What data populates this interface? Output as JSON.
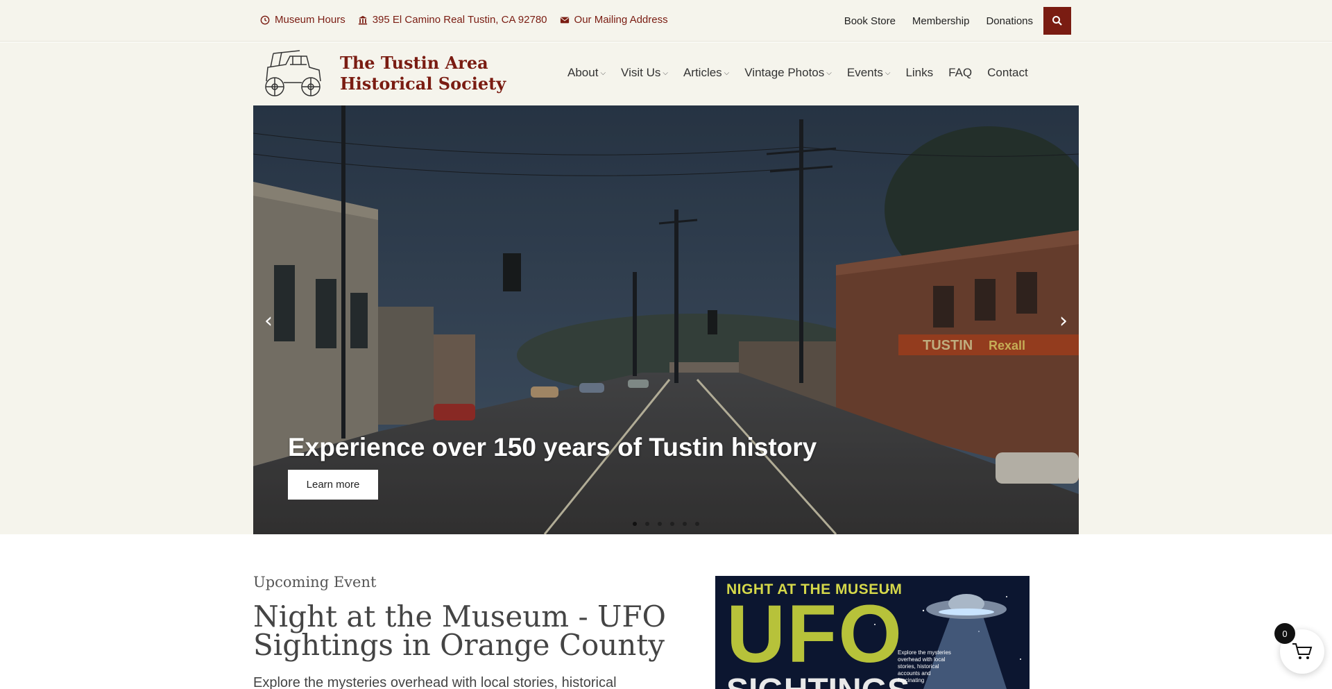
{
  "topbar": {
    "hours": "Museum Hours",
    "address": "395 El Camino Real Tustin, CA 92780",
    "mailing": "Our Mailing Address",
    "links": [
      "Book Store",
      "Membership",
      "Donations"
    ]
  },
  "header": {
    "title_line1": "The Tustin Area",
    "title_line2": "Historical Society"
  },
  "nav": {
    "items": [
      {
        "label": "About",
        "dropdown": true
      },
      {
        "label": "Visit Us",
        "dropdown": true
      },
      {
        "label": "Articles",
        "dropdown": true
      },
      {
        "label": "Vintage Photos",
        "dropdown": true
      },
      {
        "label": "Events",
        "dropdown": true
      },
      {
        "label": "Links",
        "dropdown": false
      },
      {
        "label": "FAQ",
        "dropdown": false
      },
      {
        "label": "Contact",
        "dropdown": false
      }
    ]
  },
  "hero": {
    "caption": "Experience over 150 years of Tustin history",
    "button": "Learn more",
    "slides": 6,
    "active_slide": 1
  },
  "event": {
    "kicker": "Upcoming Event",
    "title": "Night at the Museum - UFO Sightings in Orange County",
    "description": "Explore the mysteries overhead with local stories, historical"
  },
  "poster": {
    "header": "NIGHT AT THE MUSEUM",
    "big": "UFO",
    "sub": "SIGHTINGS",
    "text": "Explore the mysteries overhead with local stories, historical accounts and fascinating"
  },
  "cart": {
    "count": "0"
  },
  "colors": {
    "brand": "#7a1c12",
    "band": "#f5f4ec"
  },
  "icons": [
    "clock-icon",
    "museum-icon",
    "envelope-icon",
    "search-icon",
    "cart-icon",
    "chevron-left-icon",
    "chevron-right-icon"
  ]
}
